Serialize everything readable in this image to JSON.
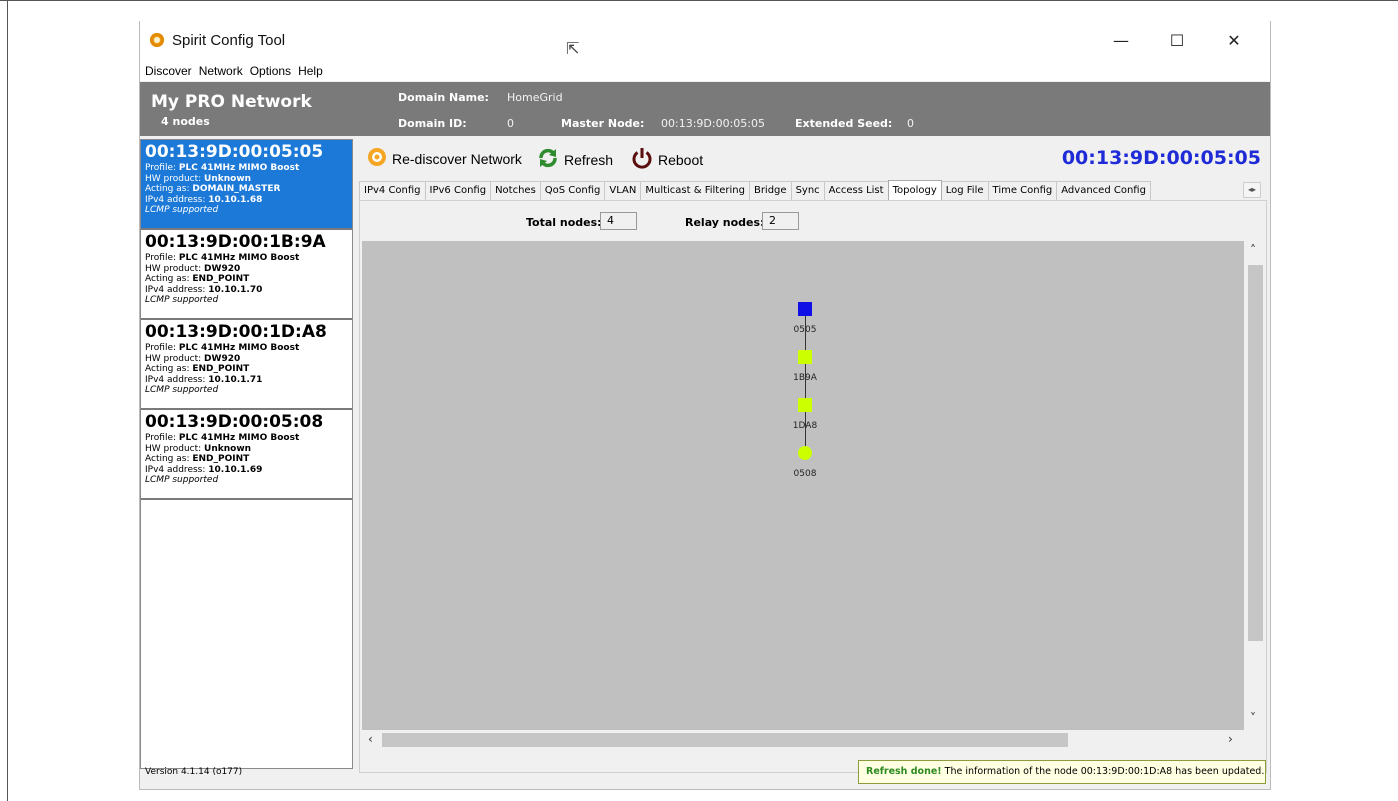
{
  "app": {
    "title": "Spirit Config Tool",
    "window_controls": {
      "minimize": "—",
      "maximize": "☐",
      "close": "✕"
    }
  },
  "menu": [
    "Discover",
    "Network",
    "Options",
    "Help"
  ],
  "network": {
    "name": "My PRO Network",
    "node_count": "4 nodes",
    "domain_name_label": "Domain Name:",
    "domain_name": "HomeGrid",
    "domain_id_label": "Domain ID:",
    "domain_id": "0",
    "master_node_label": "Master Node:",
    "master_node": "00:13:9D:00:05:05",
    "extended_seed_label": "Extended Seed:",
    "extended_seed": "0"
  },
  "nodes": [
    {
      "mac": "00:13:9D:00:05:05",
      "profile_label": "Profile: ",
      "profile": "PLC 41MHz MIMO Boost",
      "hw_label": "HW product: ",
      "hw": "Unknown",
      "acting_label": "Acting as: ",
      "acting": "DOMAIN_MASTER",
      "ip_label": "IPv4 address: ",
      "ip": "10.10.1.68",
      "lcmp": "LCMP supported",
      "selected": true
    },
    {
      "mac": "00:13:9D:00:1B:9A",
      "profile_label": "Profile: ",
      "profile": "PLC 41MHz MIMO Boost",
      "hw_label": "HW product: ",
      "hw": "DW920",
      "acting_label": "Acting as: ",
      "acting": "END_POINT",
      "ip_label": "IPv4 address: ",
      "ip": "10.10.1.70",
      "lcmp": "LCMP supported",
      "selected": false
    },
    {
      "mac": "00:13:9D:00:1D:A8",
      "profile_label": "Profile: ",
      "profile": "PLC 41MHz MIMO Boost",
      "hw_label": "HW product: ",
      "hw": "DW920",
      "acting_label": "Acting as: ",
      "acting": "END_POINT",
      "ip_label": "IPv4 address: ",
      "ip": "10.10.1.71",
      "lcmp": "LCMP supported",
      "selected": false
    },
    {
      "mac": "00:13:9D:00:05:08",
      "profile_label": "Profile: ",
      "profile": "PLC 41MHz MIMO Boost",
      "hw_label": "HW product: ",
      "hw": "Unknown",
      "acting_label": "Acting as: ",
      "acting": "END_POINT",
      "ip_label": "IPv4 address: ",
      "ip": "10.10.1.69",
      "lcmp": "LCMP supported",
      "selected": false
    }
  ],
  "version": "Version 4.1.14 (o177)",
  "toolbar": {
    "rediscover_label": "Re-discover Network",
    "refresh_label": "Refresh",
    "reboot_label": "Reboot",
    "selected_mac": "00:13:9D:00:05:05"
  },
  "tabs": [
    "IPv4 Config",
    "IPv6 Config",
    "Notches",
    "QoS Config",
    "VLAN",
    "Multicast & Filtering",
    "Bridge",
    "Sync",
    "Access List",
    "Topology",
    "Log File",
    "Time Config",
    "Advanced Config"
  ],
  "active_tab": "Topology",
  "topology": {
    "total_nodes_label": "Total nodes:",
    "total_nodes": "4",
    "relay_nodes_label": "Relay nodes:",
    "relay_nodes": "2",
    "graph_nodes": [
      {
        "label": "0505",
        "shape": "square",
        "color": "#1010e6"
      },
      {
        "label": "1B9A",
        "shape": "square",
        "color": "#ccff00"
      },
      {
        "label": "1DA8",
        "shape": "square",
        "color": "#ccff00"
      },
      {
        "label": "0508",
        "shape": "circle",
        "color": "#ccff00"
      }
    ]
  },
  "status": {
    "strong": "Refresh done!",
    "message": " The information of the node 00:13:9D:00:1D:A8 has been updated."
  },
  "colors": {
    "header_bg": "#7a7a7a",
    "selected_node_bg": "#1c79d8",
    "mac_title": "#1e2bd6",
    "canvas_bg": "#c0c0c0"
  }
}
